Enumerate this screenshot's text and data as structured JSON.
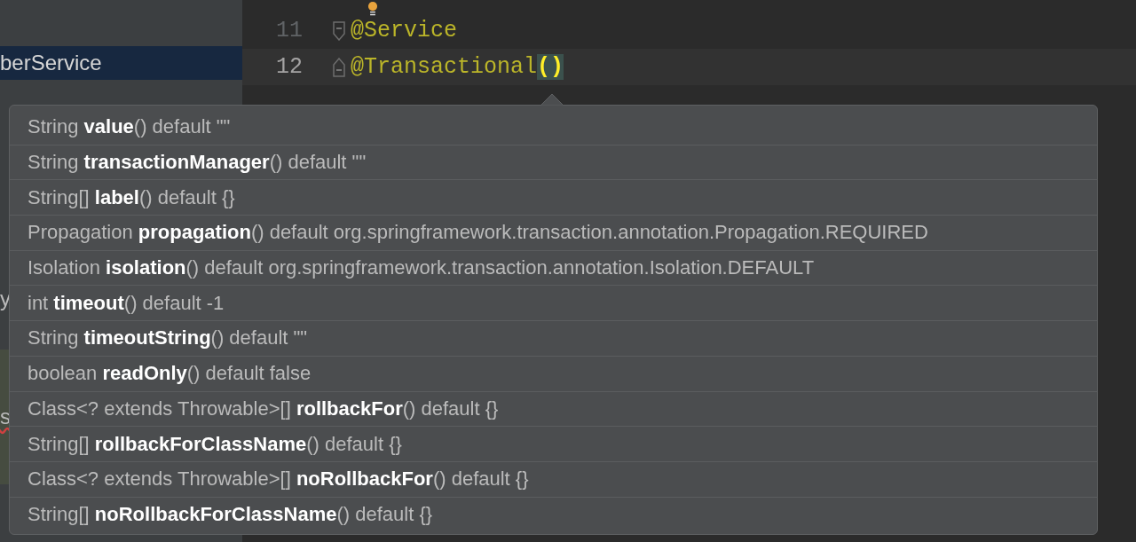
{
  "sidebar": {
    "items": [
      {
        "text": "berService",
        "selected": true,
        "highlighted": false,
        "error": false
      },
      {
        "text": "y",
        "selected": false,
        "highlighted": false,
        "error": false
      },
      {
        "text": "s",
        "selected": false,
        "highlighted": true,
        "error": true
      }
    ]
  },
  "editor": {
    "lines": [
      {
        "number": "11",
        "code": "@Service",
        "current": false,
        "kind": "annotation"
      },
      {
        "number": "12",
        "code": "@Transactional",
        "parens": "()",
        "current": true,
        "kind": "annotation"
      }
    ]
  },
  "popup": {
    "items": [
      {
        "text": "String **value**() default \"\""
      },
      {
        "text": "String **transactionManager**() default \"\""
      },
      {
        "text": "String[] **label**() default {}"
      },
      {
        "text": "Propagation **propagation**() default org.springframework.transaction.annotation.Propagation.REQUIRED"
      },
      {
        "text": "Isolation **isolation**() default org.springframework.transaction.annotation.Isolation.DEFAULT"
      },
      {
        "text": "int **timeout**() default -1"
      },
      {
        "text": "String **timeoutString**() default \"\""
      },
      {
        "text": "boolean **readOnly**() default false"
      },
      {
        "text": "Class<? extends Throwable>[] **rollbackFor**() default {}"
      },
      {
        "text": "String[] **rollbackForClassName**() default {}"
      },
      {
        "text": "Class<? extends Throwable>[] **noRollbackFor**() default {}"
      },
      {
        "text": "String[] **noRollbackForClassName**() default {}"
      }
    ]
  }
}
